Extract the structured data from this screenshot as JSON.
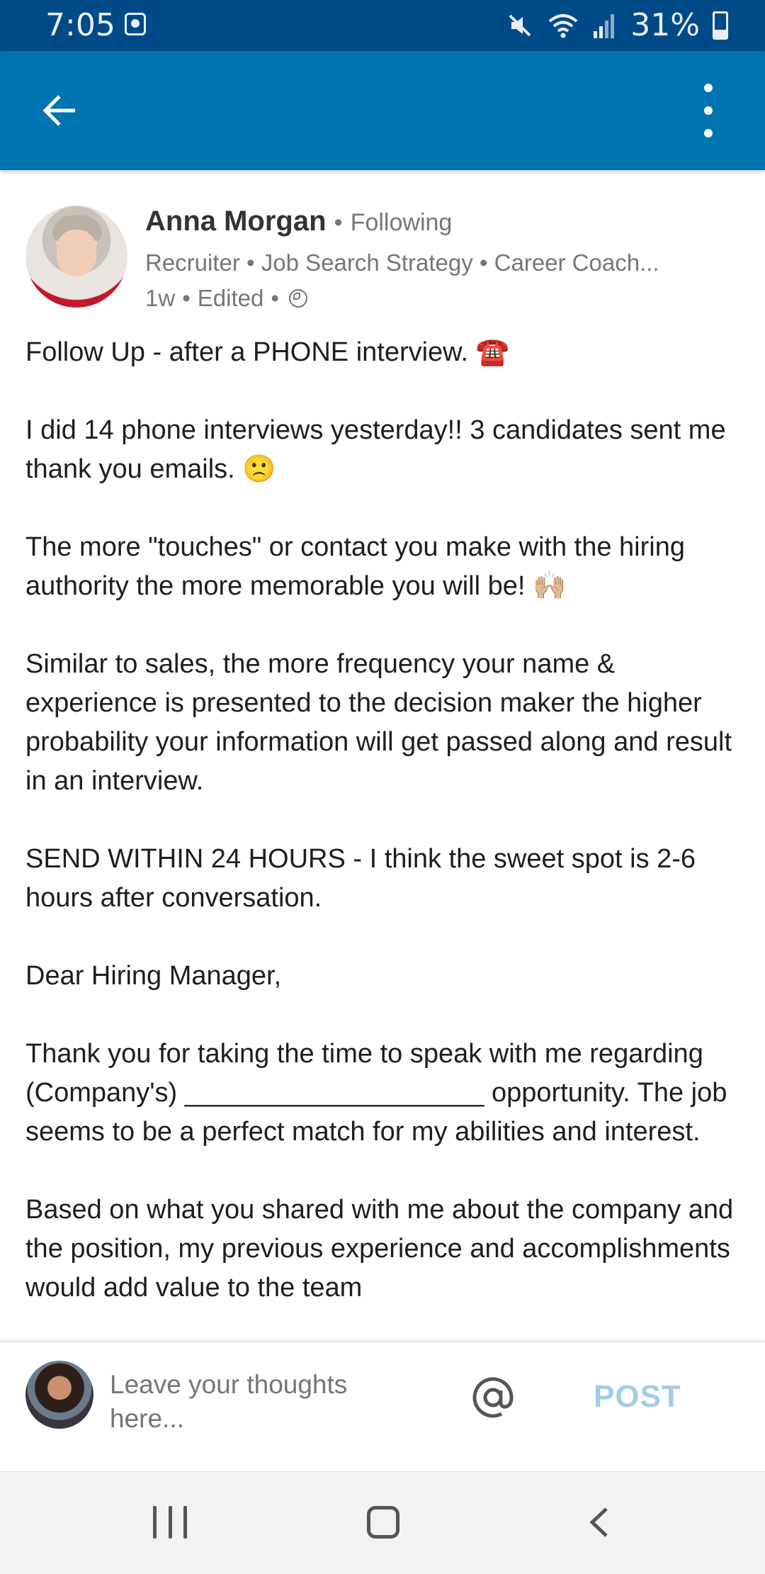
{
  "status_bar": {
    "time": "7:05",
    "battery": "31%",
    "icons": [
      "notification-icon",
      "mute-icon",
      "wifi-icon",
      "signal-icon",
      "battery-icon"
    ],
    "battery_level": 0.31
  },
  "app_bar": {
    "back_icon": "back-arrow-icon",
    "menu_icon": "more-vertical-icon"
  },
  "post": {
    "author_name": "Anna Morgan",
    "separator": "•",
    "follow_status": "Following",
    "headline": "Recruiter • Job Search Strategy • Career Coach...",
    "age": "1w",
    "edited": "Edited",
    "visibility_icon": "globe-icon",
    "paragraphs": [
      "Follow Up - after a PHONE interview. ☎️",
      "I did 14 phone interviews yesterday!! 3 candidates sent me thank you emails.  🙁",
      "The more \"touches\" or contact you make with the hiring authority the more memorable you will be! 🙌🏼",
      "Similar to sales, the more frequency your name & experience is presented to the decision maker the higher probability your information will get passed along and result in an interview.",
      "SEND WITHIN 24 HOURS - I think the sweet spot is 2-6 hours after conversation.",
      "Dear Hiring Manager,",
      "Thank you for taking the time to speak with me regarding (Company's) ____________________ opportunity. The job seems to be a perfect match for my abilities and interest.",
      "Based on what you shared with me about the company and the position, my previous experience and accomplishments would add value to the team"
    ]
  },
  "comment_bar": {
    "placeholder": "Leave your thoughts here...",
    "mention_icon": "at-sign-icon",
    "post_label": "POST",
    "post_color": "#a3cbe7"
  },
  "nav_bar": {
    "icons": [
      "recents-icon",
      "home-icon",
      "back-icon"
    ]
  },
  "colors": {
    "status_bar": "#004a87",
    "app_bar": "#0073b1"
  }
}
